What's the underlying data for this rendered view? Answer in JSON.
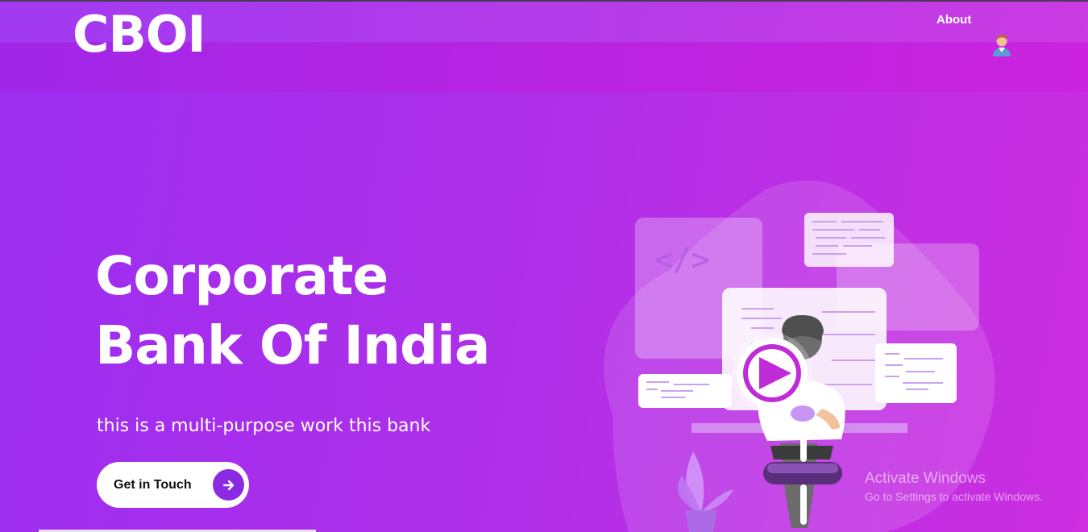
{
  "header": {
    "logo": "CBOI",
    "nav_about": "About"
  },
  "hero": {
    "title_line1": "Corporate",
    "title_line2": "Bank Of India",
    "subtitle": "this is a multi-purpose work this bank",
    "cta_label": "Get in Touch"
  },
  "illustration": {
    "code_symbol": "</>"
  },
  "watermark": {
    "title": "Activate Windows",
    "subtitle": "Go to Settings to activate Windows."
  },
  "icons": [
    "avatar-icon",
    "arrow-right-icon",
    "play-icon",
    "code-icon",
    "plant-icon"
  ],
  "colors": {
    "accent": "#8a2be2",
    "gradient_start": "#9b2ef0",
    "gradient_end": "#cc2ee0"
  }
}
